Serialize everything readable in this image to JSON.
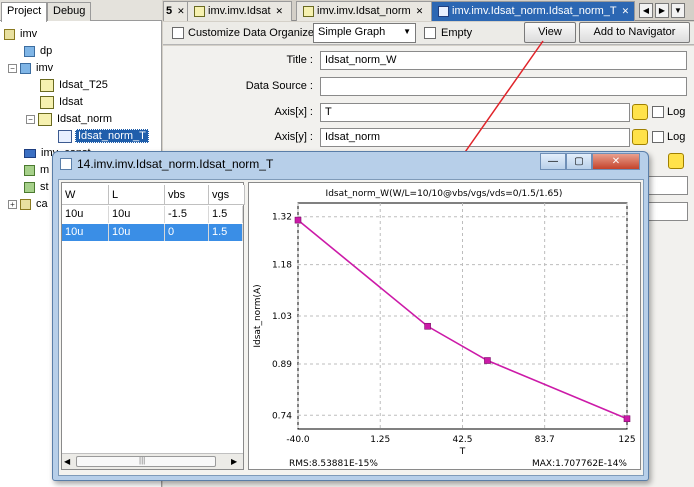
{
  "left_panel": {
    "tabs": [
      {
        "label": "Project"
      },
      {
        "label": "Debug"
      }
    ],
    "tree": [
      {
        "label": "imv"
      },
      {
        "label": "dp"
      },
      {
        "label": "imv"
      },
      {
        "label": "Idsat_T25"
      },
      {
        "label": "Idsat"
      },
      {
        "label": "Idsat_norm"
      },
      {
        "label": "Idsat_norm_T"
      },
      {
        "label": "imv_const"
      },
      {
        "label": "m"
      },
      {
        "label": "st"
      },
      {
        "label": "ca"
      }
    ]
  },
  "editor_tabs": {
    "items": [
      {
        "label": "5"
      },
      {
        "label": "imv.imv.Idsat"
      },
      {
        "label": "imv.imv.Idsat_norm"
      },
      {
        "label": "imv.imv.Idsat_norm.Idsat_norm_T"
      }
    ]
  },
  "toolbar": {
    "customize_label": "Customize Data Organize",
    "graph_type": "Simple Graph",
    "empty_label": "Empty",
    "view_label": "View",
    "add_nav_label": "Add to Navigator"
  },
  "form": {
    "title_label": "Title :",
    "title_value": "Idsat_norm_W",
    "datasource_label": "Data Source :",
    "datasource_value": "",
    "axis_x_label": "Axis[x] :",
    "axis_x_value": "T",
    "axis_y_label": "Axis[y] :",
    "axis_y_value": "Idsat_norm",
    "log_label": "Log"
  },
  "window": {
    "title": "14.imv.imv.Idsat_norm.Idsat_norm_T",
    "table": {
      "columns": [
        "W",
        "L",
        "vbs",
        "vgs"
      ],
      "rows": [
        [
          "10u",
          "10u",
          "-1.5",
          "1.5"
        ],
        [
          "10u",
          "10u",
          "0",
          "1.5"
        ]
      ]
    }
  },
  "chart_data": {
    "type": "line",
    "title": "Idsat_norm_W(W/L=10/10@vbs/vgs/vds=0/1.5/1.65)",
    "xlabel": "T",
    "ylabel": "Idsat_norm(A)",
    "xlim": [
      -40.0,
      125
    ],
    "ylim": [
      0.7,
      1.36
    ],
    "x_ticks": [
      "-40.0",
      "1.25",
      "42.5",
      "83.7",
      "125"
    ],
    "y_ticks": [
      "1.32",
      "1.18",
      "1.03",
      "0.89",
      "0.74"
    ],
    "x": [
      -40,
      25,
      55,
      125
    ],
    "y": [
      1.31,
      1.0,
      0.9,
      0.73
    ],
    "color": "#cc1aa8",
    "grid": true,
    "rms_label": "RMS:8.53881E-15%",
    "max_label": "MAX:1.707762E-14%"
  },
  "colors": {
    "accent": "#2c67b3",
    "arrow": "#e0242a",
    "selection": "#3a8ee6"
  }
}
